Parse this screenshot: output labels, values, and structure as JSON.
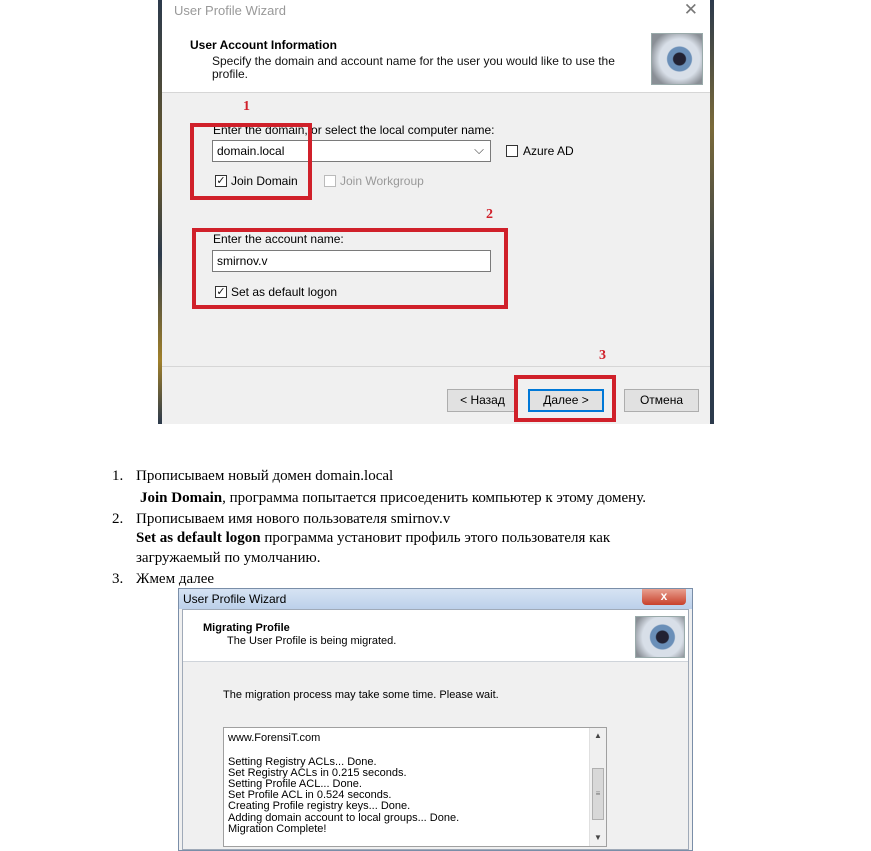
{
  "wizard1": {
    "title": "User Profile Wizard",
    "close_glyph": "✕",
    "header_title": "User Account  Information",
    "header_subtitle": "Specify the domain and account name for the user you would like to use the profile.",
    "domain_label": "Enter the domain, or select the local computer name:",
    "domain_value": "domain.local",
    "azure_label": "Azure AD",
    "azure_checked": false,
    "join_domain_label": "Join Domain",
    "join_domain_checked": true,
    "join_workgroup_label": "Join Workgroup",
    "join_workgroup_checked": false,
    "account_label": "Enter the account name:",
    "account_value": "smirnov.v",
    "default_logon_label": "Set as default logon",
    "default_logon_checked": true,
    "back_label": "< Назад",
    "next_label": "Далее >",
    "cancel_label": "Отмена",
    "icon": "eye-icon"
  },
  "annotations": {
    "num1": "1",
    "num2": "2",
    "num3": "3",
    "color": "#d0202a"
  },
  "instructions": {
    "item1_num": "1.",
    "item1_text": "Прописываем новый домен domain.local",
    "item1_bold": "Join Domain",
    "item1_rest": ", программа попытается присоеденить компьютер к этому домену.",
    "item2_num": "2.",
    "item2_text": "Прописываем имя нового пользователя smirnov.v",
    "item2_bold": "Set as default logon",
    "item2_rest": " программа установит профиль этого пользователя как",
    "item2_rest2": "загружаемый по умолчанию.",
    "item3_num": "3.",
    "item3_text": "Жмем далее"
  },
  "wizard2": {
    "title": "User Profile Wizard",
    "close_glyph": "x",
    "header_title": "Migrating Profile",
    "header_subtitle": "The User Profile is being migrated.",
    "wait_text": "The migration process may take some time. Please wait.",
    "log_lines": [
      "www.ForensiT.com",
      "",
      "Setting Registry ACLs... Done.",
      "Set Registry ACLs in 0.215 seconds.",
      "Setting Profile ACL... Done.",
      "Set Profile ACL in 0.524 seconds.",
      "Creating Profile registry keys... Done.",
      "Adding domain account to local groups... Done.",
      "Migration Complete!"
    ],
    "icon": "eye-icon"
  }
}
